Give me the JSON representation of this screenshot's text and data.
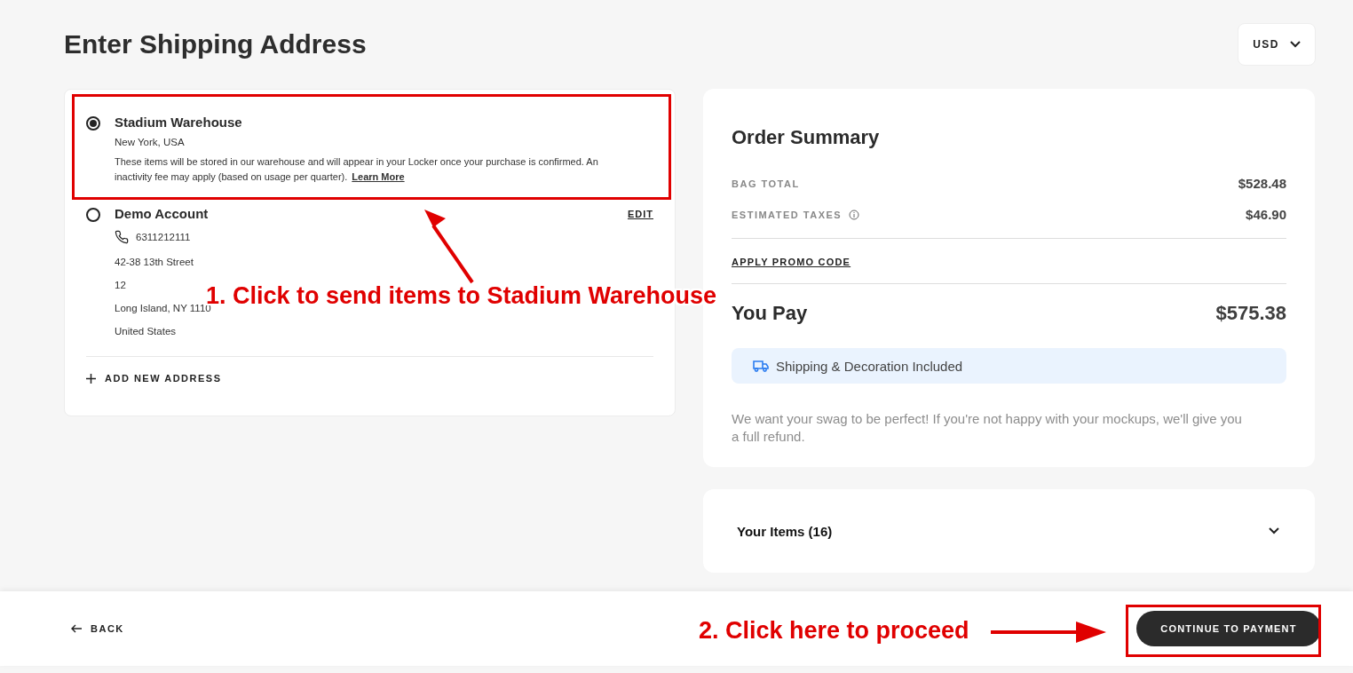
{
  "page": {
    "title": "Enter Shipping Address",
    "currency": "USD"
  },
  "addresses": [
    {
      "kind": "warehouse",
      "selected": true,
      "name": "Stadium Warehouse",
      "location": "New York, USA",
      "note": "These items will be stored in our warehouse and will appear in your Locker once your purchase is confirmed. An inactivity fee may apply (based on usage per quarter).",
      "link": "Learn More"
    },
    {
      "kind": "contact",
      "selected": false,
      "name": "Demo Account",
      "action": "EDIT",
      "phone": "6311212111",
      "lines": [
        "42-38 13th Street",
        "12",
        "Long Island, NY 1110",
        "United States"
      ]
    }
  ],
  "add_address": "ADD NEW ADDRESS",
  "order_summary": {
    "title": "Order Summary",
    "rows": [
      {
        "label": "BAG TOTAL",
        "value": "$528.48",
        "info": false
      },
      {
        "label": "ESTIMATED TAXES",
        "value": "$46.90",
        "info": true
      }
    ],
    "promo": "APPLY PROMO CODE",
    "total_label": "You Pay",
    "total": "$575.38",
    "shipping": "Shipping & Decoration Included",
    "guarantee": "We want your swag to be perfect! If you're not happy with your mockups, we'll give you a full refund."
  },
  "items": {
    "label": "Your Items (16)",
    "expanded": false
  },
  "footer": {
    "back": "BACK",
    "continue": "CONTINUE TO PAYMENT"
  },
  "annotations": [
    {
      "text": "1. Click to send items to Stadium Warehouse"
    },
    {
      "text": "2. Click here to proceed"
    }
  ]
}
